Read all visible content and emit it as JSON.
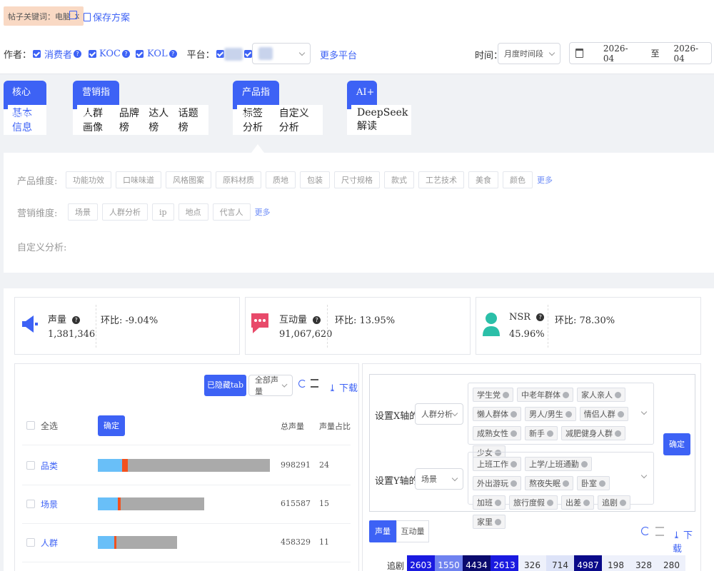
{
  "filter_bar": {
    "keyword_tag": "帖子关键词：电脑",
    "keyword_close": "x",
    "save_plan": "保存方案"
  },
  "author_row": {
    "label": "作者：",
    "options": [
      "消费者",
      "KOC",
      "KOL"
    ],
    "platform_label": "平台：",
    "more_platform": "更多平台",
    "time_label": "时间：",
    "time_select": "月度时间段",
    "date_start": "2026-04",
    "date_to": "至",
    "date_end": "2026-04"
  },
  "metric_tabs": [
    {
      "head": "核心指标",
      "items": [
        "基本信息"
      ]
    },
    {
      "head": "营销指标",
      "items": [
        "人群画像",
        "品牌榜",
        "达人榜",
        "话题榜"
      ]
    },
    {
      "head": "产品指标",
      "items": [
        "标签分析",
        "自定义分析"
      ]
    },
    {
      "head": "AI+",
      "items": [
        "DeepSeek解读"
      ]
    }
  ],
  "dimension_panel": {
    "product_label": "产品维度:",
    "product_chips": [
      "功能功效",
      "口味味道",
      "风格图案",
      "原料材质",
      "质地",
      "包装",
      "尺寸规格",
      "款式",
      "工艺技术",
      "美食",
      "颜色"
    ],
    "more1": "更多",
    "marketing_label": "营销维度:",
    "marketing_chips": [
      "场景",
      "人群分析",
      "ip",
      "地点",
      "代言人"
    ],
    "more2": "更多",
    "custom_label": "自定义分析:"
  },
  "stats": [
    {
      "name": "声量",
      "value": "1,381,346",
      "ratio": "环比: -9.04%",
      "color": "#3d62f5"
    },
    {
      "name": "互动量",
      "value": "91,067,620",
      "ratio": "环比: 13.95%",
      "color": "#e84a6a"
    },
    {
      "name": "NSR",
      "value": "45.96%",
      "ratio": "环比: 78.30%",
      "color": "#2bbfa8"
    }
  ],
  "left_panel": {
    "hidden_tab_btn": "已隐藏tab",
    "all_volume_select": "全部声量",
    "download": "下载",
    "select_all": "全选",
    "confirm": "确定",
    "col_total": "总声量",
    "col_ratio": "声量占比",
    "rows": [
      {
        "name": "品类",
        "total": "998291",
        "ratio": "24",
        "bar_fraction": 0.992,
        "blue": 0.14,
        "red": 0.035
      },
      {
        "name": "场景",
        "total": "615587",
        "ratio": "15",
        "bar_fraction": 0.612,
        "blue": 0.19,
        "red": 0.025
      },
      {
        "name": "人群",
        "total": "458329",
        "ratio": "11",
        "bar_fraction": 0.456,
        "blue": 0.21,
        "red": 0.025
      }
    ]
  },
  "right_panel": {
    "x_axis_label": "设置X轴的值",
    "x_select": "人群分析",
    "x_tags": [
      "学生党",
      "中老年群体",
      "家人亲人",
      "懒人群体",
      "男人/男生",
      "情侣人群",
      "成熟女性",
      "新手",
      "减肥健身人群",
      "少女"
    ],
    "y_axis_label": "设置Y轴的值",
    "y_select": "场景",
    "y_tags": [
      "上班工作",
      "上学/上班通勤",
      "外出游玩",
      "熬夜失眠",
      "卧室",
      "加班",
      "旅行度假",
      "出差",
      "追剧",
      "家里"
    ],
    "confirm": "确定",
    "tabs": [
      "声量",
      "互动量"
    ],
    "download": "下载",
    "heat_row_label": "追剧",
    "heat_values": [
      "2603",
      "1550",
      "4434",
      "2613",
      "326",
      "714",
      "4987",
      "198",
      "328",
      "280"
    ]
  }
}
